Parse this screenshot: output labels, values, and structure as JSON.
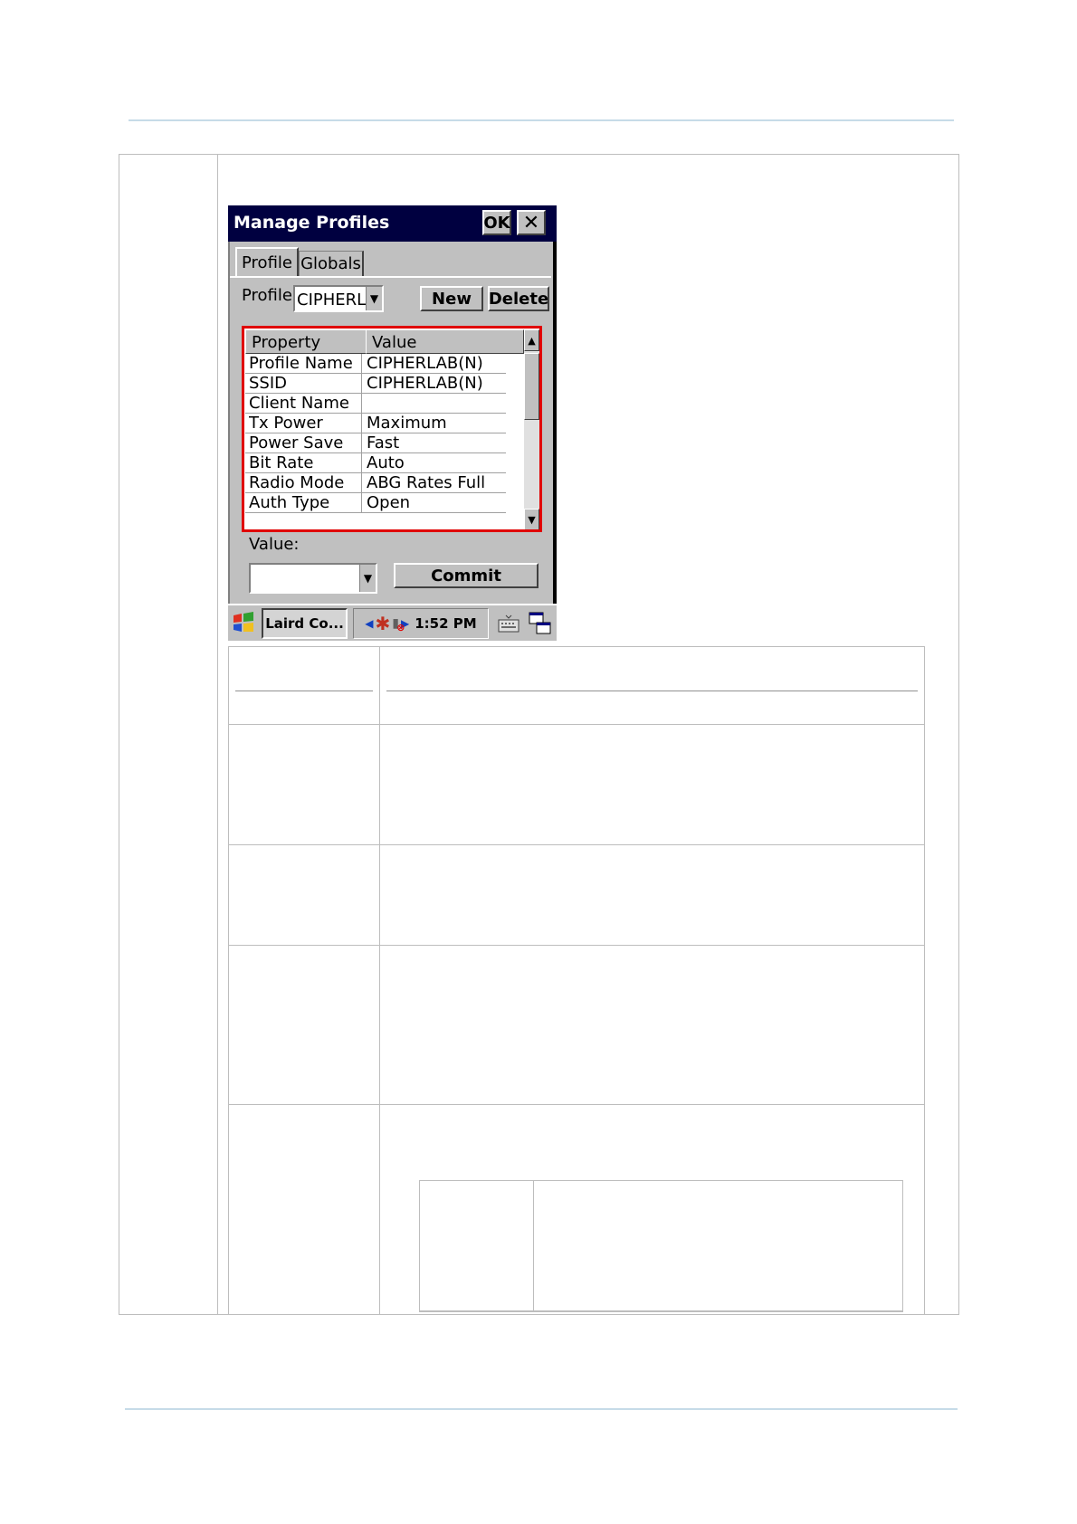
{
  "dialog": {
    "title": "Manage Profiles",
    "ok_label": "OK",
    "close_label": "✕"
  },
  "tabs": [
    {
      "label": "Profile",
      "active": true
    },
    {
      "label": "Globals",
      "active": false
    }
  ],
  "profile": {
    "label": "Profile",
    "selected": "CIPHERLAB(",
    "new_label": "New",
    "delete_label": "Delete"
  },
  "grid": {
    "headers": [
      "Property",
      "Value"
    ],
    "rows": [
      {
        "property": "Profile Name",
        "value": "CIPHERLAB(N)"
      },
      {
        "property": "SSID",
        "value": "CIPHERLAB(N)"
      },
      {
        "property": "Client Name",
        "value": ""
      },
      {
        "property": "Tx Power",
        "value": "Maximum"
      },
      {
        "property": "Power Save",
        "value": "Fast"
      },
      {
        "property": "Bit Rate",
        "value": "Auto"
      },
      {
        "property": "Radio Mode",
        "value": "ABG Rates Full"
      },
      {
        "property": "Auth Type",
        "value": "Open"
      }
    ]
  },
  "value_section": {
    "label": "Value:",
    "selected": "",
    "commit_label": "Commit"
  },
  "taskbar": {
    "app_label": "Laird Co...",
    "time": "1:52 PM"
  },
  "colors": {
    "titlebar": "#000040",
    "highlight": "#e00000",
    "face": "#c0c0c0"
  }
}
